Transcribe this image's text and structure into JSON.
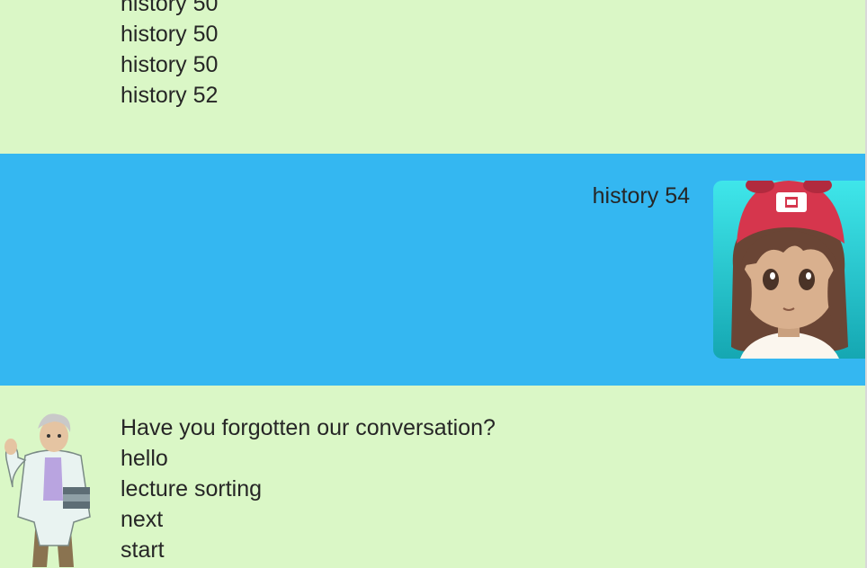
{
  "chat": {
    "messages": [
      {
        "sender": "bot",
        "lines": [
          "history 50",
          "history 50",
          "history 50",
          "history 52"
        ]
      },
      {
        "sender": "user",
        "lines": [
          "history 54"
        ]
      },
      {
        "sender": "bot",
        "lines": [
          "Have you forgotten our conversation?",
          "hello",
          "lecture sorting",
          "next",
          "start"
        ]
      }
    ]
  },
  "colors": {
    "bot_bubble": "#daf7c6",
    "user_bubble": "#34b7f1",
    "text": "#262626"
  },
  "icons": {
    "user_avatar": "girl-trainer-avatar-icon",
    "bot_avatar": "professor-avatar-icon"
  }
}
